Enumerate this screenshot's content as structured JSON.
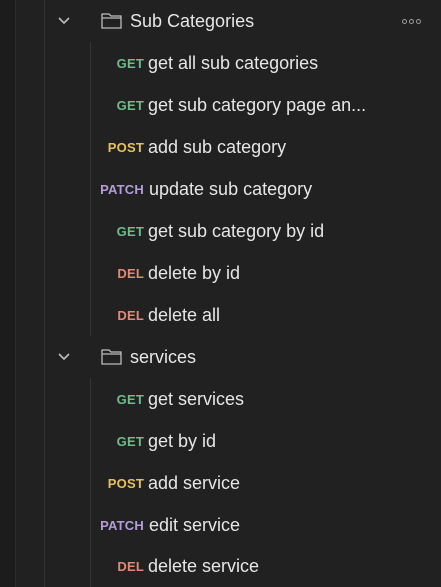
{
  "colors": {
    "background": "#212121",
    "text": "#e6e6e6",
    "get": "#6bbd8a",
    "post": "#e8c15a",
    "patch": "#b39ddb",
    "del": "#e08a75",
    "icon": "#bdbdbd"
  },
  "tree": {
    "folders": [
      {
        "name": "Sub Categories",
        "expanded": true,
        "chevron_icon": "chevron-down-icon",
        "folder_icon": "folder-icon",
        "more_icon": "more-options-icon",
        "requests": [
          {
            "method": "GET",
            "name": "get all sub categories"
          },
          {
            "method": "GET",
            "name": "get sub category page an..."
          },
          {
            "method": "POST",
            "name": "add sub category"
          },
          {
            "method": "PATCH",
            "name": "update sub category"
          },
          {
            "method": "GET",
            "name": "get sub category by id"
          },
          {
            "method": "DEL",
            "name": "delete by id"
          },
          {
            "method": "DEL",
            "name": "delete all"
          }
        ]
      },
      {
        "name": "services",
        "expanded": true,
        "chevron_icon": "chevron-down-icon",
        "folder_icon": "folder-icon",
        "requests": [
          {
            "method": "GET",
            "name": "get services"
          },
          {
            "method": "GET",
            "name": "get by id"
          },
          {
            "method": "POST",
            "name": "add service"
          },
          {
            "method": "PATCH",
            "name": "edit service"
          },
          {
            "method": "DEL",
            "name": "delete service"
          }
        ]
      }
    ]
  }
}
